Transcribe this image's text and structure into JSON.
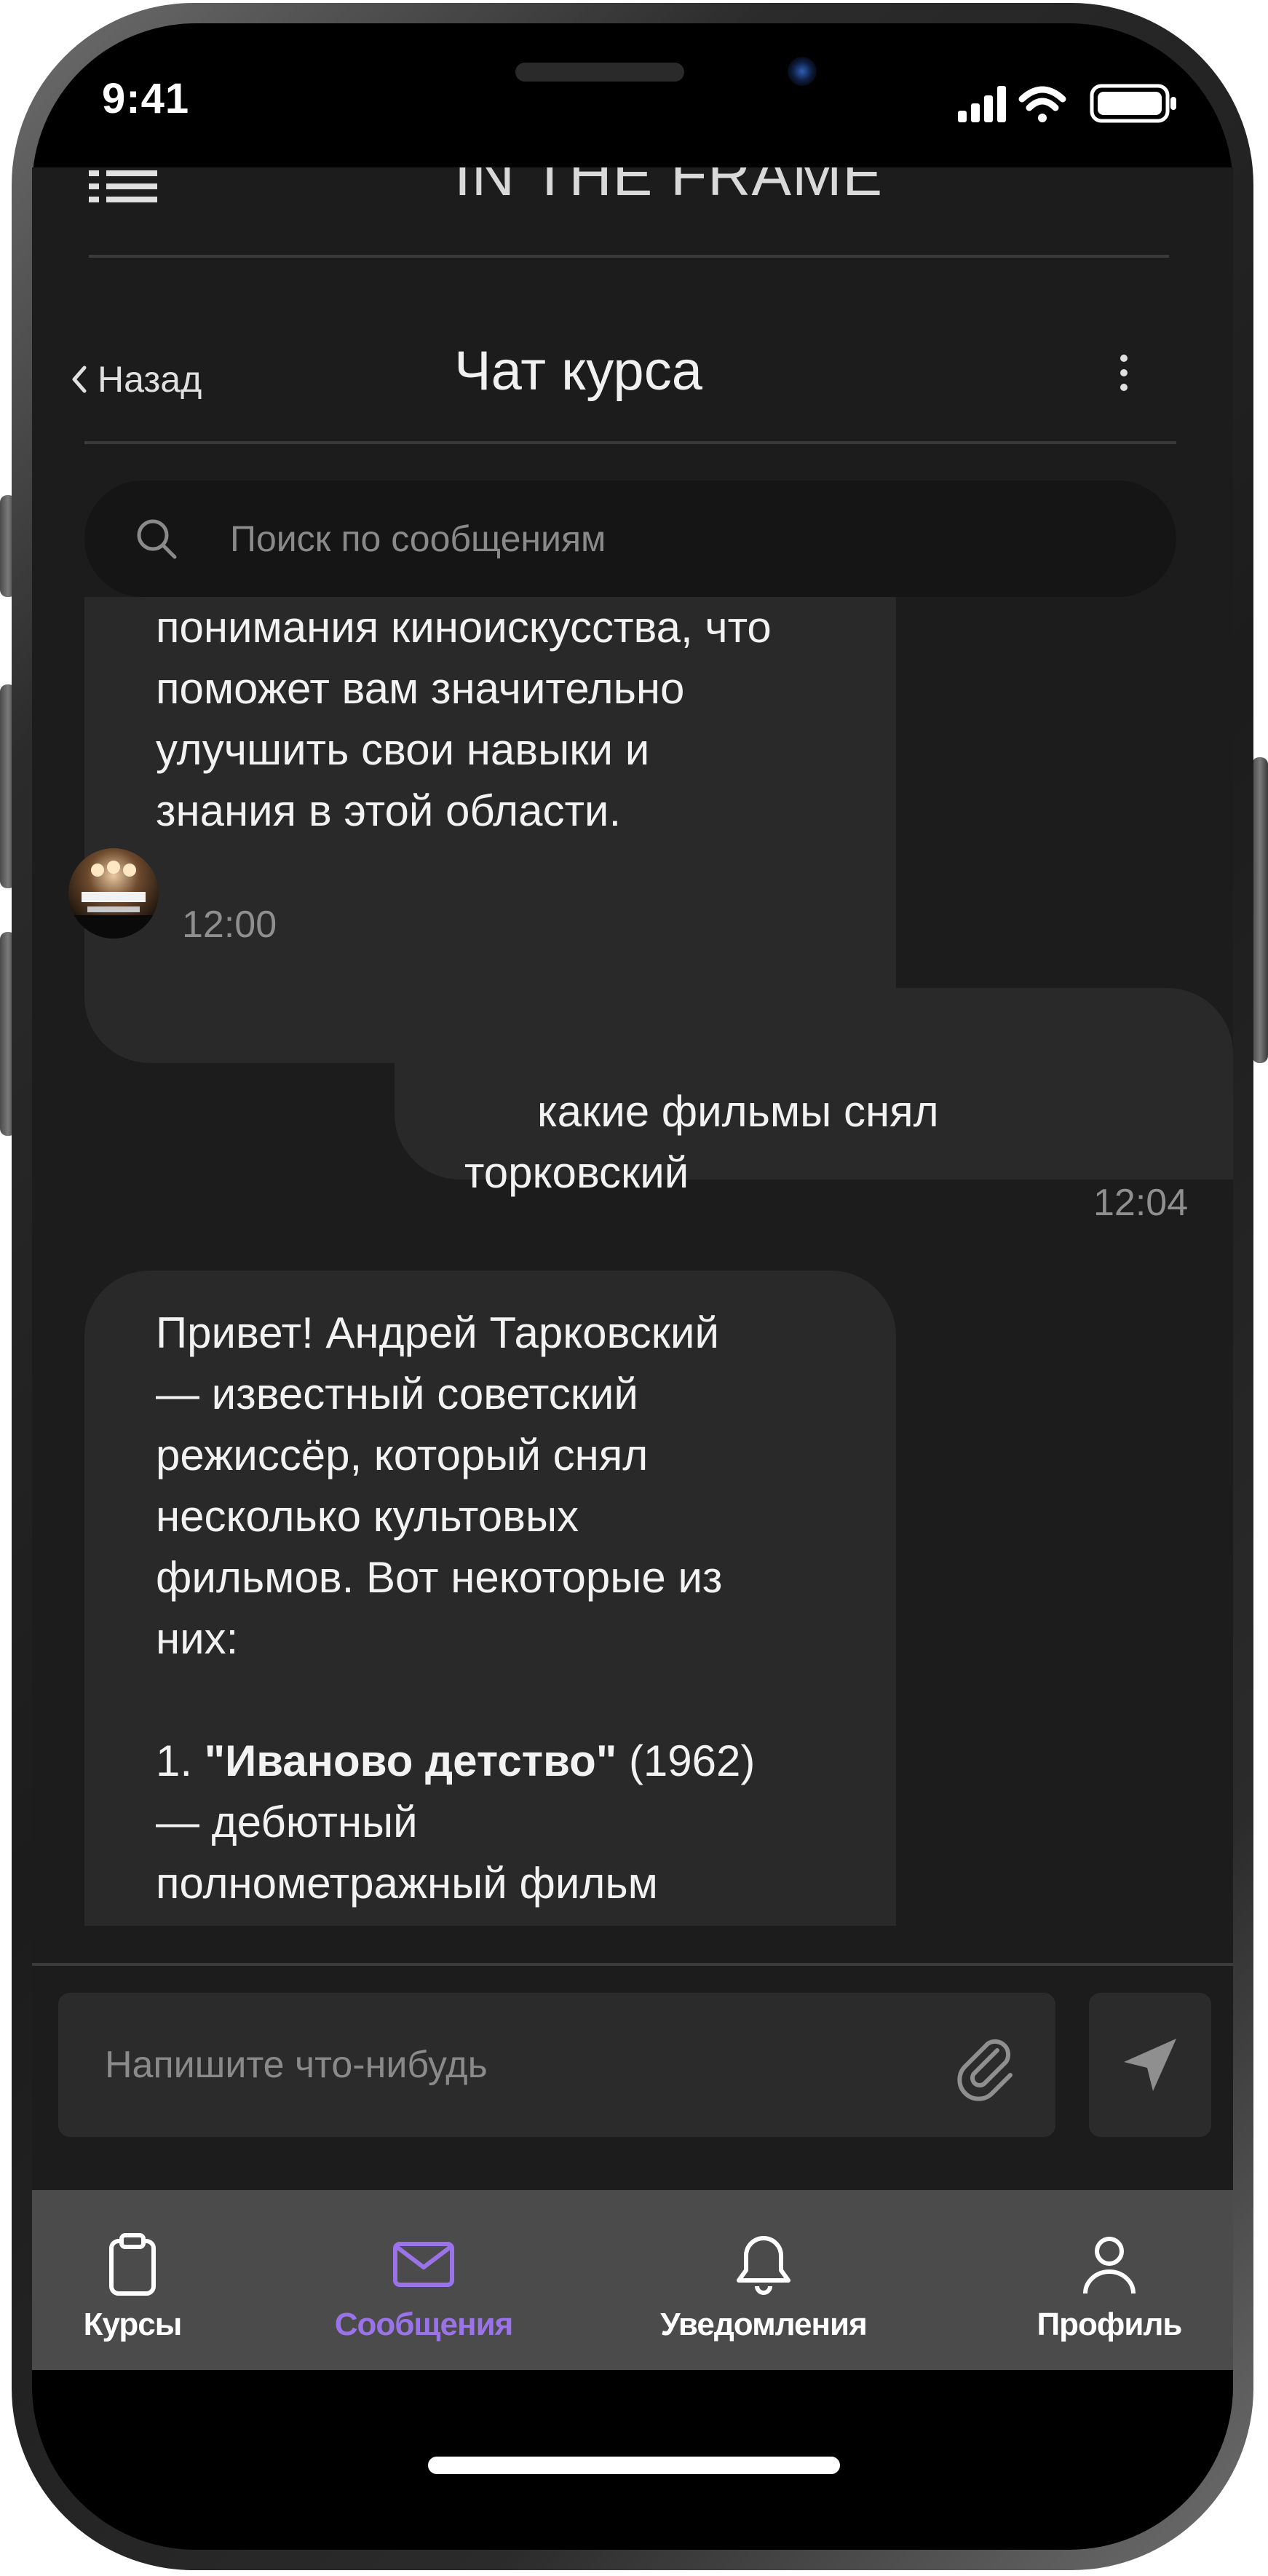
{
  "status_bar": {
    "time": "9:41",
    "icons": [
      "cellular-signal-icon",
      "wifi-icon",
      "battery-icon"
    ]
  },
  "app": {
    "brand": "IN THE FRAME",
    "menu_icon": "hamburger-menu-icon"
  },
  "header": {
    "back_label": "Назад",
    "title": "Чат курса",
    "more_icon": "kebab-menu-icon"
  },
  "search": {
    "placeholder": "Поиск по сообщениям"
  },
  "messages": [
    {
      "direction": "incoming",
      "text": "понимания киноискусства, что\nпоможет вам значительно\nулучшить свои навыки и\nзнания в этой области.",
      "time": "12:00"
    },
    {
      "direction": "outgoing",
      "text": "какие фильмы снял\nторковский",
      "time": "12:04"
    },
    {
      "direction": "incoming",
      "text_intro": "Привет! Андрей Тарковский\n— известный советский\nрежиссёр, который снял\nнесколько культовых\nфильмов. Вот некоторые из\nних:",
      "list_item_number": "1.",
      "list_item_title": "\"Иваново детство\"",
      "list_item_year": "(1962)",
      "list_item_rest": "— дебютный\nполнометражный фильм"
    }
  ],
  "composer": {
    "placeholder": "Напишите что-нибудь",
    "attach_icon": "paperclip-icon",
    "send_icon": "send-icon"
  },
  "tabbar": {
    "active_color": "#9a73e8",
    "items": [
      {
        "label": "Курсы",
        "icon": "clipboard-icon"
      },
      {
        "label": "Сообщения",
        "icon": "envelope-icon",
        "active": true
      },
      {
        "label": "Уведомления",
        "icon": "bell-icon"
      },
      {
        "label": "Профиль",
        "icon": "user-icon"
      }
    ]
  },
  "colors": {
    "screen_background": "#1c1c1c",
    "bubble": "#292929",
    "tabbar": "#4b4b4b",
    "accent": "#9a73e8"
  }
}
